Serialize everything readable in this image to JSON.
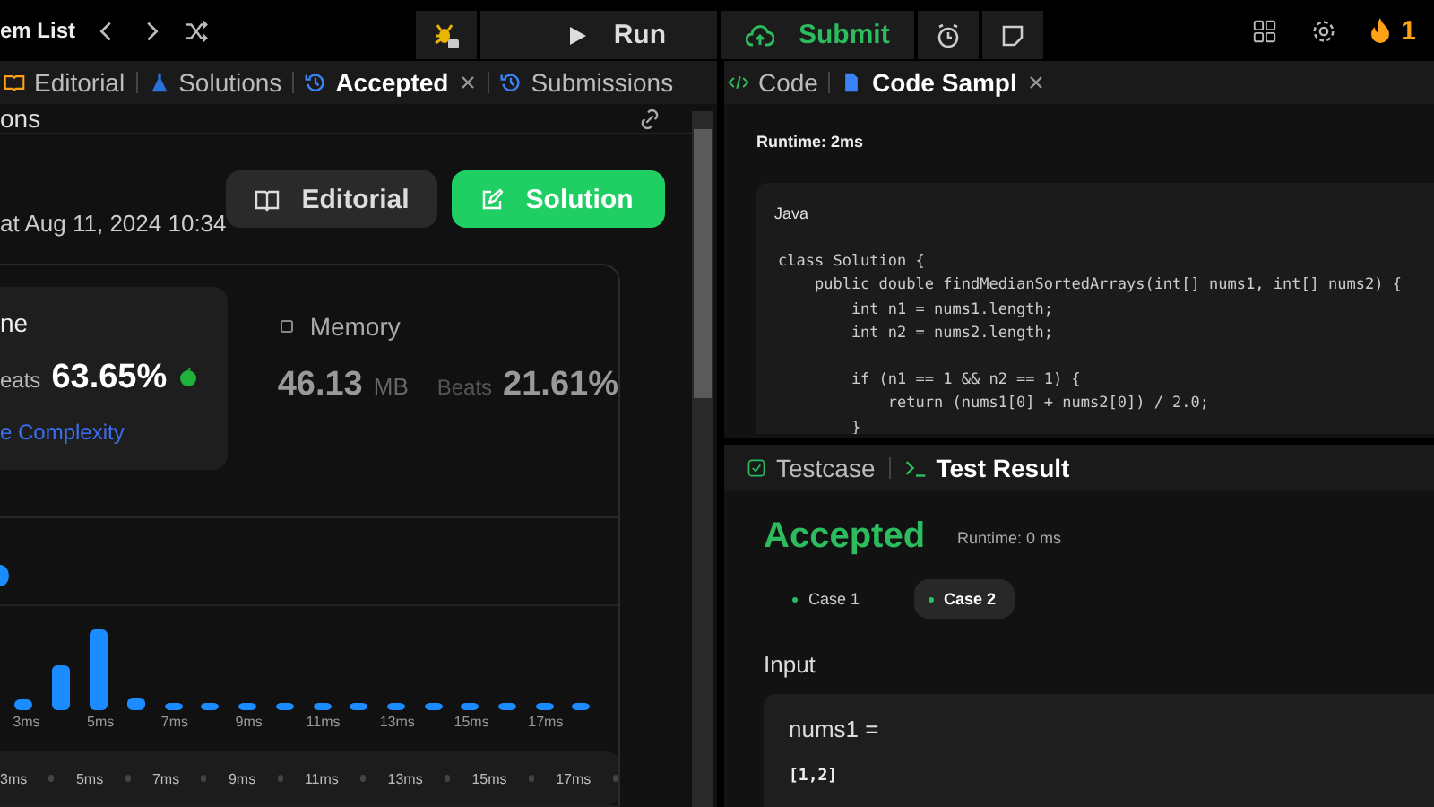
{
  "top_bar": {
    "title": "em List",
    "run": "Run",
    "submit": "Submit",
    "streak": "1"
  },
  "left_panel": {
    "tabs": [
      {
        "label": "Editorial",
        "kind": "book",
        "selected": false,
        "closable": false
      },
      {
        "label": "Solutions",
        "kind": "flask",
        "selected": false,
        "closable": false
      },
      {
        "label": "Accepted",
        "kind": "history",
        "selected": true,
        "closable": true
      },
      {
        "label": "Submissions",
        "kind": "history",
        "selected": false,
        "closable": false
      }
    ],
    "header": "ons",
    "submitted": "at Aug 11, 2024 10:34",
    "buttons": [
      {
        "label": "Editorial",
        "kind": "secondary"
      },
      {
        "label": "Solution",
        "kind": "primary"
      }
    ],
    "runtime": {
      "title": "ne",
      "beats_label": "eats",
      "beats": "63.65%",
      "link": "e Complexity"
    },
    "memory": {
      "title": "Memory",
      "value": "46.13",
      "unit": "MB",
      "beats_label": "Beats",
      "beats": "21.61%"
    },
    "chart_labels": [
      "3ms",
      "5ms",
      "7ms",
      "9ms",
      "11ms",
      "13ms",
      "15ms",
      "17ms"
    ],
    "overview_labels": [
      "3ms",
      "5ms",
      "7ms",
      "9ms",
      "11ms",
      "13ms",
      "15ms",
      "17ms"
    ]
  },
  "code_panel": {
    "tabs": [
      {
        "label": "Code",
        "kind": "code",
        "selected": false,
        "closable": false
      },
      {
        "label": "Code Sampl",
        "kind": "file",
        "selected": true,
        "closable": true
      }
    ],
    "runtime": "Runtime: 2ms",
    "language": "Java",
    "blocks": [
      [
        "class Solution {",
        "    public double findMedianSortedArrays(int[] nums1, int[] nums2) {",
        "        int n1 = nums1.length;",
        "        int n2 = nums2.length;"
      ],
      [
        "        if (n1 == 1 && n2 == 1) {",
        "            return (nums1[0] + nums2[0]) / 2.0;",
        "        }"
      ]
    ]
  },
  "result_panel": {
    "tabs": [
      {
        "label": "Testcase",
        "kind": "check",
        "selected": false
      },
      {
        "label": "Test Result",
        "kind": "terminal",
        "selected": true
      }
    ],
    "status": "Accepted",
    "runtime": "Runtime: 0 ms",
    "cases": [
      {
        "label": "Case 1",
        "selected": false
      },
      {
        "label": "Case 2",
        "selected": true
      }
    ],
    "input_title": "Input",
    "param": "nums1 =",
    "value": "[1,2]"
  }
}
